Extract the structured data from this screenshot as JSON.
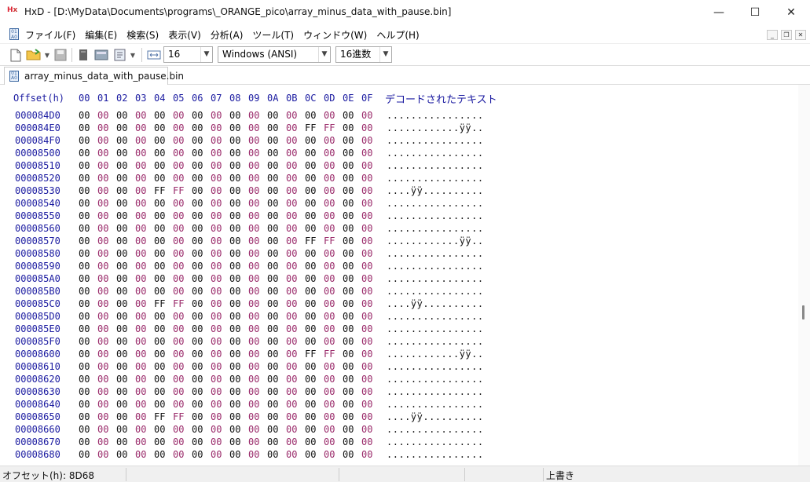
{
  "window": {
    "title": "HxD - [D:\\MyData\\Documents\\programs\\_ORANGE_pico\\array_minus_data_with_pause.bin]",
    "minimize_glyph": "—",
    "maximize_glyph": "☐",
    "close_glyph": "✕"
  },
  "menu": [
    "ファイル(F)",
    "編集(E)",
    "検索(S)",
    "表示(V)",
    "分析(A)",
    "ツール(T)",
    "ウィンドウ(W)",
    "ヘルプ(H)"
  ],
  "toolbar": {
    "bytes_per_row": "16",
    "charset": "Windows (ANSI)",
    "offset_base": "16進数"
  },
  "tab": {
    "label": "array_minus_data_with_pause.bin"
  },
  "editor": {
    "offset_header": "Offset(h)",
    "column_headers": [
      "00",
      "01",
      "02",
      "03",
      "04",
      "05",
      "06",
      "07",
      "08",
      "09",
      "0A",
      "0B",
      "0C",
      "0D",
      "0E",
      "0F"
    ],
    "decoded_header": "デコードされたテキスト",
    "rows": [
      {
        "offset": "000084D0",
        "bytes": [
          "00",
          "00",
          "00",
          "00",
          "00",
          "00",
          "00",
          "00",
          "00",
          "00",
          "00",
          "00",
          "00",
          "00",
          "00",
          "00"
        ],
        "text": "................"
      },
      {
        "offset": "000084E0",
        "bytes": [
          "00",
          "00",
          "00",
          "00",
          "00",
          "00",
          "00",
          "00",
          "00",
          "00",
          "00",
          "00",
          "FF",
          "FF",
          "00",
          "00"
        ],
        "text": "............ÿÿ.."
      },
      {
        "offset": "000084F0",
        "bytes": [
          "00",
          "00",
          "00",
          "00",
          "00",
          "00",
          "00",
          "00",
          "00",
          "00",
          "00",
          "00",
          "00",
          "00",
          "00",
          "00"
        ],
        "text": "................"
      },
      {
        "offset": "00008500",
        "bytes": [
          "00",
          "00",
          "00",
          "00",
          "00",
          "00",
          "00",
          "00",
          "00",
          "00",
          "00",
          "00",
          "00",
          "00",
          "00",
          "00"
        ],
        "text": "................"
      },
      {
        "offset": "00008510",
        "bytes": [
          "00",
          "00",
          "00",
          "00",
          "00",
          "00",
          "00",
          "00",
          "00",
          "00",
          "00",
          "00",
          "00",
          "00",
          "00",
          "00"
        ],
        "text": "................"
      },
      {
        "offset": "00008520",
        "bytes": [
          "00",
          "00",
          "00",
          "00",
          "00",
          "00",
          "00",
          "00",
          "00",
          "00",
          "00",
          "00",
          "00",
          "00",
          "00",
          "00"
        ],
        "text": "................"
      },
      {
        "offset": "00008530",
        "bytes": [
          "00",
          "00",
          "00",
          "00",
          "FF",
          "FF",
          "00",
          "00",
          "00",
          "00",
          "00",
          "00",
          "00",
          "00",
          "00",
          "00"
        ],
        "text": "....ÿÿ.........."
      },
      {
        "offset": "00008540",
        "bytes": [
          "00",
          "00",
          "00",
          "00",
          "00",
          "00",
          "00",
          "00",
          "00",
          "00",
          "00",
          "00",
          "00",
          "00",
          "00",
          "00"
        ],
        "text": "................"
      },
      {
        "offset": "00008550",
        "bytes": [
          "00",
          "00",
          "00",
          "00",
          "00",
          "00",
          "00",
          "00",
          "00",
          "00",
          "00",
          "00",
          "00",
          "00",
          "00",
          "00"
        ],
        "text": "................"
      },
      {
        "offset": "00008560",
        "bytes": [
          "00",
          "00",
          "00",
          "00",
          "00",
          "00",
          "00",
          "00",
          "00",
          "00",
          "00",
          "00",
          "00",
          "00",
          "00",
          "00"
        ],
        "text": "................"
      },
      {
        "offset": "00008570",
        "bytes": [
          "00",
          "00",
          "00",
          "00",
          "00",
          "00",
          "00",
          "00",
          "00",
          "00",
          "00",
          "00",
          "FF",
          "FF",
          "00",
          "00"
        ],
        "text": "............ÿÿ.."
      },
      {
        "offset": "00008580",
        "bytes": [
          "00",
          "00",
          "00",
          "00",
          "00",
          "00",
          "00",
          "00",
          "00",
          "00",
          "00",
          "00",
          "00",
          "00",
          "00",
          "00"
        ],
        "text": "................"
      },
      {
        "offset": "00008590",
        "bytes": [
          "00",
          "00",
          "00",
          "00",
          "00",
          "00",
          "00",
          "00",
          "00",
          "00",
          "00",
          "00",
          "00",
          "00",
          "00",
          "00"
        ],
        "text": "................"
      },
      {
        "offset": "000085A0",
        "bytes": [
          "00",
          "00",
          "00",
          "00",
          "00",
          "00",
          "00",
          "00",
          "00",
          "00",
          "00",
          "00",
          "00",
          "00",
          "00",
          "00"
        ],
        "text": "................"
      },
      {
        "offset": "000085B0",
        "bytes": [
          "00",
          "00",
          "00",
          "00",
          "00",
          "00",
          "00",
          "00",
          "00",
          "00",
          "00",
          "00",
          "00",
          "00",
          "00",
          "00"
        ],
        "text": "................"
      },
      {
        "offset": "000085C0",
        "bytes": [
          "00",
          "00",
          "00",
          "00",
          "FF",
          "FF",
          "00",
          "00",
          "00",
          "00",
          "00",
          "00",
          "00",
          "00",
          "00",
          "00"
        ],
        "text": "....ÿÿ.........."
      },
      {
        "offset": "000085D0",
        "bytes": [
          "00",
          "00",
          "00",
          "00",
          "00",
          "00",
          "00",
          "00",
          "00",
          "00",
          "00",
          "00",
          "00",
          "00",
          "00",
          "00"
        ],
        "text": "................"
      },
      {
        "offset": "000085E0",
        "bytes": [
          "00",
          "00",
          "00",
          "00",
          "00",
          "00",
          "00",
          "00",
          "00",
          "00",
          "00",
          "00",
          "00",
          "00",
          "00",
          "00"
        ],
        "text": "................"
      },
      {
        "offset": "000085F0",
        "bytes": [
          "00",
          "00",
          "00",
          "00",
          "00",
          "00",
          "00",
          "00",
          "00",
          "00",
          "00",
          "00",
          "00",
          "00",
          "00",
          "00"
        ],
        "text": "................"
      },
      {
        "offset": "00008600",
        "bytes": [
          "00",
          "00",
          "00",
          "00",
          "00",
          "00",
          "00",
          "00",
          "00",
          "00",
          "00",
          "00",
          "FF",
          "FF",
          "00",
          "00"
        ],
        "text": "............ÿÿ.."
      },
      {
        "offset": "00008610",
        "bytes": [
          "00",
          "00",
          "00",
          "00",
          "00",
          "00",
          "00",
          "00",
          "00",
          "00",
          "00",
          "00",
          "00",
          "00",
          "00",
          "00"
        ],
        "text": "................"
      },
      {
        "offset": "00008620",
        "bytes": [
          "00",
          "00",
          "00",
          "00",
          "00",
          "00",
          "00",
          "00",
          "00",
          "00",
          "00",
          "00",
          "00",
          "00",
          "00",
          "00"
        ],
        "text": "................"
      },
      {
        "offset": "00008630",
        "bytes": [
          "00",
          "00",
          "00",
          "00",
          "00",
          "00",
          "00",
          "00",
          "00",
          "00",
          "00",
          "00",
          "00",
          "00",
          "00",
          "00"
        ],
        "text": "................"
      },
      {
        "offset": "00008640",
        "bytes": [
          "00",
          "00",
          "00",
          "00",
          "00",
          "00",
          "00",
          "00",
          "00",
          "00",
          "00",
          "00",
          "00",
          "00",
          "00",
          "00"
        ],
        "text": "................"
      },
      {
        "offset": "00008650",
        "bytes": [
          "00",
          "00",
          "00",
          "00",
          "FF",
          "FF",
          "00",
          "00",
          "00",
          "00",
          "00",
          "00",
          "00",
          "00",
          "00",
          "00"
        ],
        "text": "....ÿÿ.........."
      },
      {
        "offset": "00008660",
        "bytes": [
          "00",
          "00",
          "00",
          "00",
          "00",
          "00",
          "00",
          "00",
          "00",
          "00",
          "00",
          "00",
          "00",
          "00",
          "00",
          "00"
        ],
        "text": "................"
      },
      {
        "offset": "00008670",
        "bytes": [
          "00",
          "00",
          "00",
          "00",
          "00",
          "00",
          "00",
          "00",
          "00",
          "00",
          "00",
          "00",
          "00",
          "00",
          "00",
          "00"
        ],
        "text": "................"
      },
      {
        "offset": "00008680",
        "bytes": [
          "00",
          "00",
          "00",
          "00",
          "00",
          "00",
          "00",
          "00",
          "00",
          "00",
          "00",
          "00",
          "00",
          "00",
          "00",
          "00"
        ],
        "text": "................"
      }
    ]
  },
  "status": {
    "offset": "オフセット(h): 8D68",
    "mode": "上書き"
  },
  "colors": {
    "offset_blue": "#1a1aa0",
    "odd_byte": "#9a2a6a",
    "even_byte": "#111111"
  }
}
